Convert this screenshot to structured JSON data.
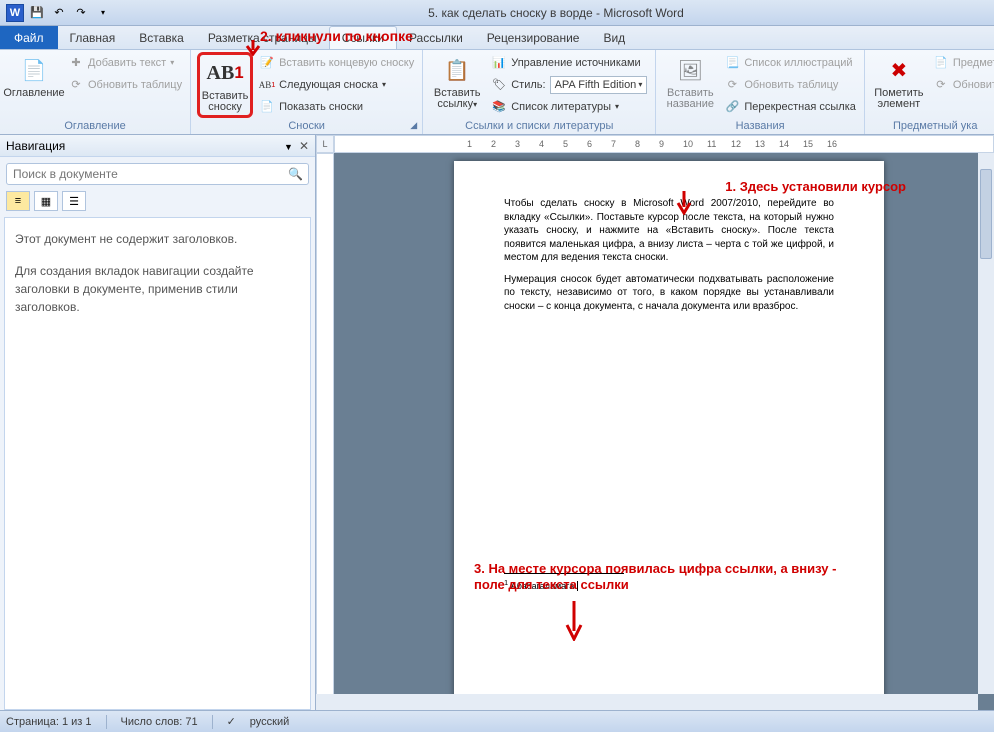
{
  "title": "5. как сделать сноску в ворде - Microsoft Word",
  "tabs": {
    "file": "Файл",
    "home": "Главная",
    "insert": "Вставка",
    "layout": "Разметка страницы",
    "references": "Ссылки",
    "mailings": "Рассылки",
    "review": "Рецензирование",
    "view": "Вид"
  },
  "ribbon": {
    "toc": {
      "title": "Оглавление",
      "main": "Оглавление",
      "add_text": "Добавить текст",
      "update": "Обновить таблицу"
    },
    "footnotes": {
      "title": "Сноски",
      "insert": "Вставить сноску",
      "insert_end": "Вставить концевую сноску",
      "next": "Следующая сноска",
      "show": "Показать сноски"
    },
    "citations": {
      "title": "Ссылки и списки литературы",
      "insert": "Вставить ссылку",
      "manage": "Управление источниками",
      "style_label": "Стиль:",
      "style_value": "APA Fifth Edition",
      "bibliography": "Список литературы"
    },
    "captions": {
      "title": "Названия",
      "insert": "Вставить название",
      "list_figures": "Список иллюстраций",
      "update": "Обновить таблицу",
      "crossref": "Перекрестная ссылка"
    },
    "index": {
      "title": "Предметный ука",
      "mark": "Пометить элемент",
      "insert": "Предмет",
      "update": "Обновит"
    }
  },
  "annotations": {
    "a1": "1. Здесь установили курсор",
    "a2": "2. кликнули по кнопке",
    "a3": "3. На месте курсора появилась цифра ссылки, а внизу - поле для текста ссылки"
  },
  "navigation": {
    "title": "Навигация",
    "search_placeholder": "Поиск в документе",
    "empty1": "Этот документ не содержит заголовков.",
    "empty2": "Для создания вкладок навигации создайте заголовки в документе, применив стили заголовков."
  },
  "document": {
    "p1": "Чтобы сделать сноску в Microsoft Word 2007/2010, перейдите во вкладку «Ссылки». Поставьте курсор после текста, на который нужно указать сноску, и нажмите на «Вставить сноску». После текста появится маленькая цифра, а внизу листа – черта с той же цифрой, и местом для ведения текста сноски.",
    "p2": "Нумерация сносок будет автоматически подхватывать расположение по тексту, независимо от того, в каком порядке вы устанавливали сноски – с конца документа, с начала документа или вразброс.",
    "footnote_num": "1",
    "footnote_text": "Абабагаламага"
  },
  "ruler": {
    "labels": [
      "1",
      "2",
      "3",
      "4",
      "5",
      "6",
      "7",
      "8",
      "9",
      "10",
      "11",
      "12",
      "13",
      "14",
      "15",
      "16"
    ]
  },
  "status": {
    "page": "Страница: 1 из 1",
    "words": "Число слов: 71",
    "lang": "русский"
  }
}
